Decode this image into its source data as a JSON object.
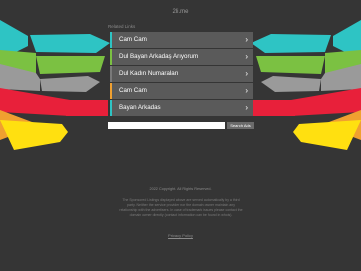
{
  "header": {
    "site_title": "2li.me"
  },
  "related_links": {
    "label": "Related Links",
    "items": [
      {
        "label": "Cam Cam",
        "accent": "#2ec4c4"
      },
      {
        "label": "Dul Bayan Arkadaş Arıyorum",
        "accent": "#7bc142"
      },
      {
        "label": "Dul Kadın Numaraları",
        "accent": "#7a7a7a"
      },
      {
        "label": "Cam Cam",
        "accent": "#f0a030"
      },
      {
        "label": "Bayan Arkadas",
        "accent": "#2ec4c4"
      }
    ]
  },
  "search": {
    "placeholder": "",
    "button_label": "Search Ads"
  },
  "footer": {
    "copyright": "2022 Copyright. All Rights Reserved.",
    "disclaimer": "The Sponsored Listings displayed above are served automatically by a third party. Neither the service provider nor the domain owner maintain any relationship with the advertisers. In case of trademark issues please contact the domain owner directly (contact information can be found in whois).",
    "privacy_label": "Privacy Policy"
  },
  "colors": {
    "background": "#353535",
    "teal": "#2ec4c4",
    "green": "#7bc142",
    "gray": "#9a9a9a",
    "red": "#e8203a",
    "orange": "#f0a030",
    "yellow": "#ffe010"
  }
}
